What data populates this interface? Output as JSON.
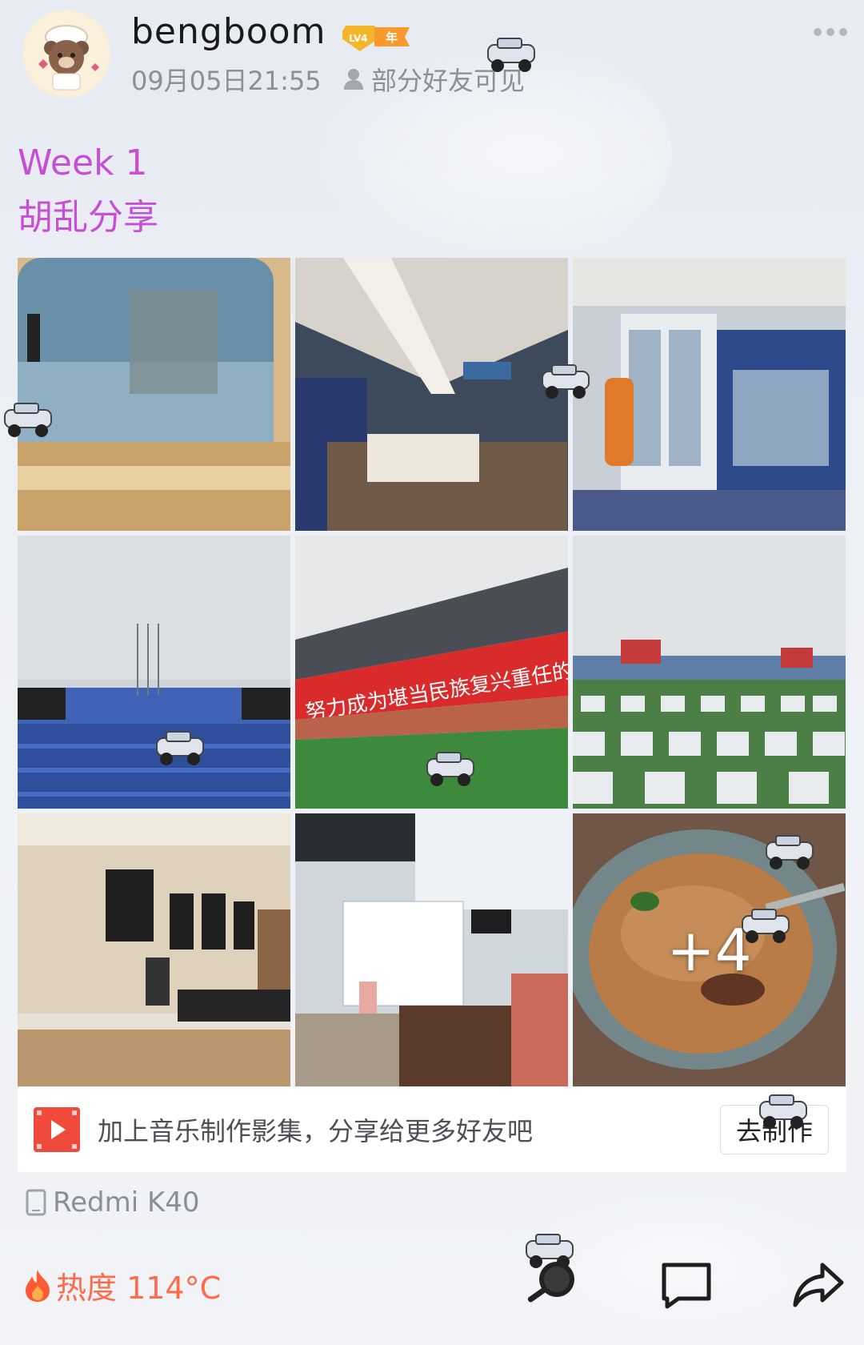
{
  "header": {
    "username": "bengboom",
    "level_badge": "LV4",
    "level_badge_suffix": "年",
    "timestamp": "09月05日21:55",
    "visibility": "部分好友可见"
  },
  "post": {
    "line1": "Week 1",
    "line2": "胡乱分享"
  },
  "photos": {
    "more_count": "+4"
  },
  "music_banner": {
    "text": "加上音乐制作影集，分享给更多好友吧",
    "button_label": "去制作"
  },
  "device": {
    "name": "Redmi K40"
  },
  "heat": {
    "label": "热度 114°C"
  },
  "photo_banner_text": "努力成为堪当民族复兴重任的时代新人",
  "colors": {
    "post_text": "#c64fd6",
    "heat": "#ff6a4a",
    "meta": "#8a8f99"
  },
  "icons": {
    "more": "more-dots-icon",
    "visibility": "person-icon",
    "device": "phone-icon",
    "heat": "fire-icon",
    "pan": "frying-pan-icon",
    "comment": "comment-icon",
    "share": "share-icon",
    "video": "video-play-icon"
  }
}
